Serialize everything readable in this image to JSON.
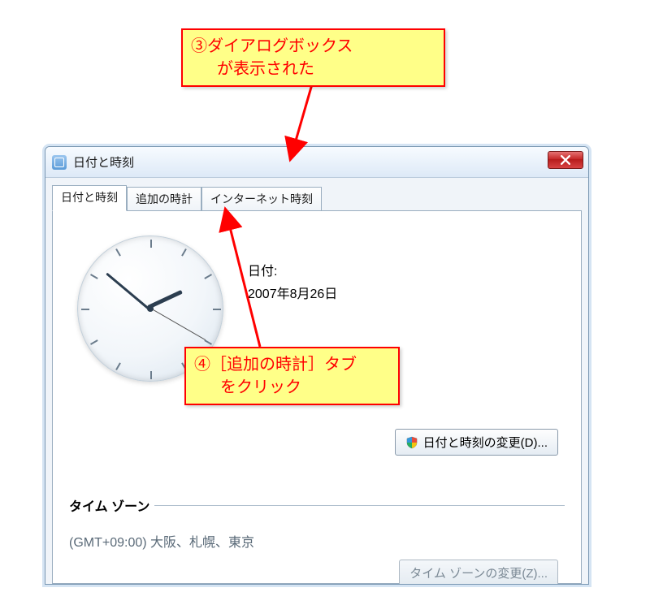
{
  "callouts": {
    "c3_line1": "③ダイアログボックス",
    "c3_line2": "が表示された",
    "c4_line1": "④［追加の時計］タブ",
    "c4_line2": "をクリック"
  },
  "window": {
    "title": "日付と時刻"
  },
  "tabs": {
    "active": "日付と時刻",
    "additional": "追加の時計",
    "internet": "インターネット時刻"
  },
  "date_section": {
    "label": "日付:",
    "value": "2007年8月26日"
  },
  "change_button": "日付と時刻の変更(D)...",
  "timezone": {
    "section_title": "タイム ゾーン",
    "value": "(GMT+09:00) 大阪、札幌、東京",
    "change_label": "タイム ゾーンの変更(Z)..."
  }
}
